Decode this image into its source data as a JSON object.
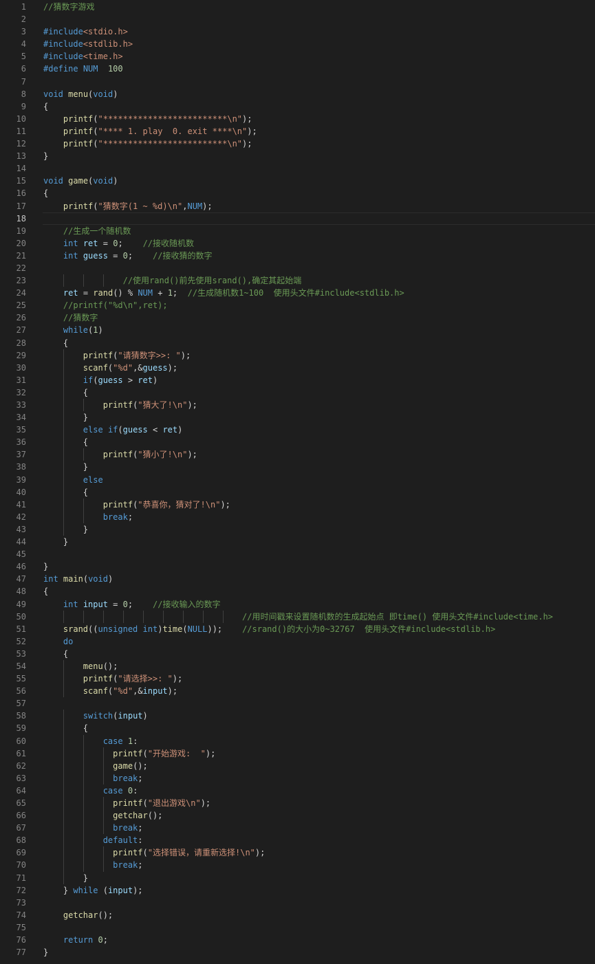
{
  "editor": {
    "current_line": 18,
    "colors": {
      "background": "#1e1e1e",
      "line_number": "#858585",
      "keyword": "#569cd6",
      "string": "#ce9178",
      "comment": "#6a9955",
      "function": "#dcdcaa",
      "number": "#b5cea8"
    },
    "lines": [
      {
        "n": "1",
        "t": "//猜数字游戏"
      },
      {
        "n": "2",
        "t": ""
      },
      {
        "n": "3",
        "t": "#include<stdio.h>"
      },
      {
        "n": "4",
        "t": "#include<stdlib.h>"
      },
      {
        "n": "5",
        "t": "#include<time.h>"
      },
      {
        "n": "6",
        "t": "#define NUM  100"
      },
      {
        "n": "7",
        "t": ""
      },
      {
        "n": "8",
        "t": "void menu(void)"
      },
      {
        "n": "9",
        "t": "{"
      },
      {
        "n": "10",
        "t": "    printf(\"*************************\\n\");"
      },
      {
        "n": "11",
        "t": "    printf(\"**** 1. play  0. exit ****\\n\");"
      },
      {
        "n": "12",
        "t": "    printf(\"*************************\\n\");"
      },
      {
        "n": "13",
        "t": "}"
      },
      {
        "n": "14",
        "t": ""
      },
      {
        "n": "15",
        "t": "void game(void)"
      },
      {
        "n": "16",
        "t": "{"
      },
      {
        "n": "17",
        "t": "    printf(\"猜数字(1 ~ %d)\\n\",NUM);"
      },
      {
        "n": "18",
        "t": ""
      },
      {
        "n": "19",
        "t": "    //生成一个随机数"
      },
      {
        "n": "20",
        "t": "    int ret = 0;    //接收随机数"
      },
      {
        "n": "21",
        "t": "    int guess = 0;    //接收猜的数字"
      },
      {
        "n": "22",
        "t": ""
      },
      {
        "n": "23",
        "t": "                //使用rand()前先使用srand(),确定其起始端"
      },
      {
        "n": "24",
        "t": "    ret = rand() % NUM + 1;  //生成随机数1~100  使用头文件#include<stdlib.h>"
      },
      {
        "n": "25",
        "t": "    //printf(\"%d\\n\",ret);"
      },
      {
        "n": "26",
        "t": "    //猜数字"
      },
      {
        "n": "27",
        "t": "    while(1)"
      },
      {
        "n": "28",
        "t": "    {"
      },
      {
        "n": "29",
        "t": "        printf(\"请猜数字>>: \");"
      },
      {
        "n": "30",
        "t": "        scanf(\"%d\",&guess);"
      },
      {
        "n": "31",
        "t": "        if(guess > ret)"
      },
      {
        "n": "32",
        "t": "        {"
      },
      {
        "n": "33",
        "t": "            printf(\"猜大了!\\n\");"
      },
      {
        "n": "34",
        "t": "        }"
      },
      {
        "n": "35",
        "t": "        else if(guess < ret)"
      },
      {
        "n": "36",
        "t": "        {"
      },
      {
        "n": "37",
        "t": "            printf(\"猜小了!\\n\");"
      },
      {
        "n": "38",
        "t": "        }"
      },
      {
        "n": "39",
        "t": "        else"
      },
      {
        "n": "40",
        "t": "        {"
      },
      {
        "n": "41",
        "t": "            printf(\"恭喜你，猜对了!\\n\");"
      },
      {
        "n": "42",
        "t": "            break;"
      },
      {
        "n": "43",
        "t": "        }"
      },
      {
        "n": "44",
        "t": "    }"
      },
      {
        "n": "45",
        "t": ""
      },
      {
        "n": "46",
        "t": "}"
      },
      {
        "n": "47",
        "t": "int main(void)"
      },
      {
        "n": "48",
        "t": "{"
      },
      {
        "n": "49",
        "t": "    int input = 0;    //接收输入的数字"
      },
      {
        "n": "50",
        "t": "                                        //用时间戳来设置随机数的生成起始点 即time() 使用头文件#include<time.h>"
      },
      {
        "n": "51",
        "t": "    srand((unsigned int)time(NULL));    //srand()的大小为0~32767  使用头文件#include<stdlib.h>"
      },
      {
        "n": "52",
        "t": "    do"
      },
      {
        "n": "53",
        "t": "    {"
      },
      {
        "n": "54",
        "t": "        menu();"
      },
      {
        "n": "55",
        "t": "        printf(\"请选择>>: \");"
      },
      {
        "n": "56",
        "t": "        scanf(\"%d\",&input);"
      },
      {
        "n": "57",
        "t": ""
      },
      {
        "n": "58",
        "t": "        switch(input)"
      },
      {
        "n": "59",
        "t": "        {"
      },
      {
        "n": "60",
        "t": "            case 1:"
      },
      {
        "n": "61",
        "t": "              printf(\"开始游戏:  \");"
      },
      {
        "n": "62",
        "t": "              game();"
      },
      {
        "n": "63",
        "t": "              break;"
      },
      {
        "n": "64",
        "t": "            case 0:"
      },
      {
        "n": "65",
        "t": "              printf(\"退出游戏\\n\");"
      },
      {
        "n": "66",
        "t": "              getchar();"
      },
      {
        "n": "67",
        "t": "              break;"
      },
      {
        "n": "68",
        "t": "            default:"
      },
      {
        "n": "69",
        "t": "              printf(\"选择错误，请重新选择!\\n\");"
      },
      {
        "n": "70",
        "t": "              break;"
      },
      {
        "n": "71",
        "t": "        }"
      },
      {
        "n": "72",
        "t": "    } while (input);"
      },
      {
        "n": "73",
        "t": ""
      },
      {
        "n": "74",
        "t": "    getchar();"
      },
      {
        "n": "75",
        "t": ""
      },
      {
        "n": "76",
        "t": "    return 0;"
      },
      {
        "n": "77",
        "t": "}"
      }
    ]
  }
}
